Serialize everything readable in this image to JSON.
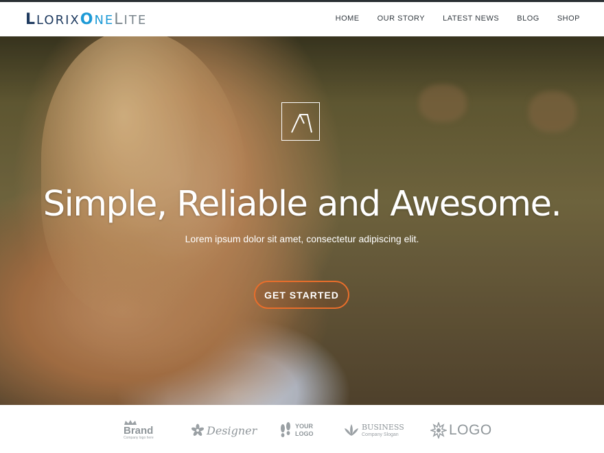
{
  "header": {
    "logo": {
      "part1": "L",
      "part2": "LORIX",
      "part3": "O",
      "part4": "NE",
      "part5": "L",
      "part6": "ITE"
    },
    "nav": [
      "HOME",
      "OUR STORY",
      "LATEST NEWS",
      "BLOG",
      "SHOP"
    ]
  },
  "hero": {
    "title": "Simple, Reliable and Awesome.",
    "subtitle": "Lorem ipsum dolor sit amet, consectetur adipiscing elit.",
    "cta_label": "GET STARTED",
    "icon": "logo-mark-icon"
  },
  "brands": [
    {
      "name": "Brand",
      "tagline": "Company logo here",
      "icon": "crown-icon"
    },
    {
      "name": "Designer",
      "icon": "flower-icon"
    },
    {
      "name_line1": "YOUR",
      "name_line2": "LOGO",
      "icon": "footprints-icon"
    },
    {
      "name": "BUSINESS",
      "tagline": "Company Slogan",
      "icon": "leaf-icon"
    },
    {
      "name": "LOGO",
      "icon": "starburst-icon"
    }
  ],
  "colors": {
    "accent": "#e96e2b",
    "logo_dark": "#1e3a5f",
    "logo_blue": "#1d9ad6",
    "logo_gray": "#7a858c"
  }
}
